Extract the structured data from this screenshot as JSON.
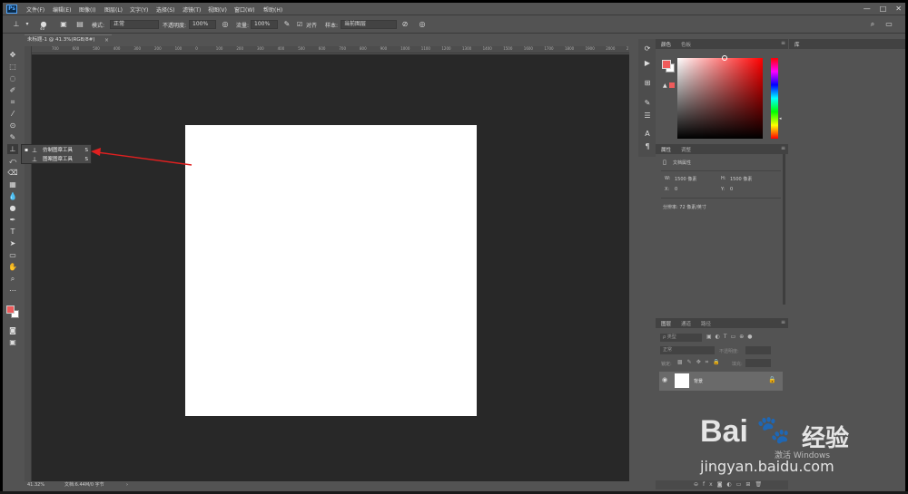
{
  "app": {
    "logo": "Ps"
  },
  "menu": [
    "文件(F)",
    "编辑(E)",
    "图像(I)",
    "图层(L)",
    "文字(Y)",
    "选择(S)",
    "滤镜(T)",
    "视图(V)",
    "窗口(W)",
    "帮助(H)"
  ],
  "options_bar": {
    "brush_size": "40",
    "mode_label": "模式:",
    "mode_value": "正常",
    "opacity_label": "不透明度:",
    "opacity_value": "100%",
    "flow_label": "流量:",
    "flow_value": "100%",
    "aligned_label": "对齐",
    "sample_label": "样本:",
    "sample_value": "当前图层"
  },
  "document": {
    "tab_title": "未标题-1 @ 41.3%(RGB/8#)",
    "zoom": "41.32%",
    "doc_size": "文档:6.44M/0 字节"
  },
  "ruler_ticks": [
    "700",
    "600",
    "500",
    "400",
    "300",
    "200",
    "100",
    "0",
    "100",
    "200",
    "300",
    "400",
    "500",
    "600",
    "700",
    "800",
    "900",
    "1000",
    "1100",
    "1200",
    "1300",
    "1400",
    "1500",
    "1600",
    "1700",
    "1800",
    "1900",
    "2000",
    "2100",
    "2200"
  ],
  "tool_flyout": [
    {
      "label": "仿制图章工具",
      "key": "S"
    },
    {
      "label": "图案图章工具",
      "key": "S"
    }
  ],
  "color_panel": {
    "tabs": [
      "颜色",
      "色板"
    ],
    "fg_color": "#ee5b5b",
    "bg_color": "#ffffff"
  },
  "properties_panel": {
    "tabs": [
      "属性",
      "调整"
    ],
    "title": "文档属性",
    "w_label": "W:",
    "w_value": "1500 像素",
    "h_label": "H:",
    "h_value": "1500 像素",
    "x_label": "X:",
    "x_value": "0",
    "y_label": "Y:",
    "y_value": "0",
    "resolution": "分辨率: 72 像素/英寸"
  },
  "layers_panel": {
    "tabs": [
      "图层",
      "通道",
      "路径"
    ],
    "filter_placeholder": "ρ 类型",
    "blend_mode": "正常",
    "opacity_label": "不透明度:",
    "lock_label": "锁定:",
    "fill_label": "填充:",
    "layer_name": "背景"
  },
  "library_panel": {
    "tab": "库"
  },
  "watermark": {
    "brand": "Bai",
    "brand_cn": "经验",
    "site": "jingyan.baidu.com",
    "overlay": "激活 Windows"
  }
}
